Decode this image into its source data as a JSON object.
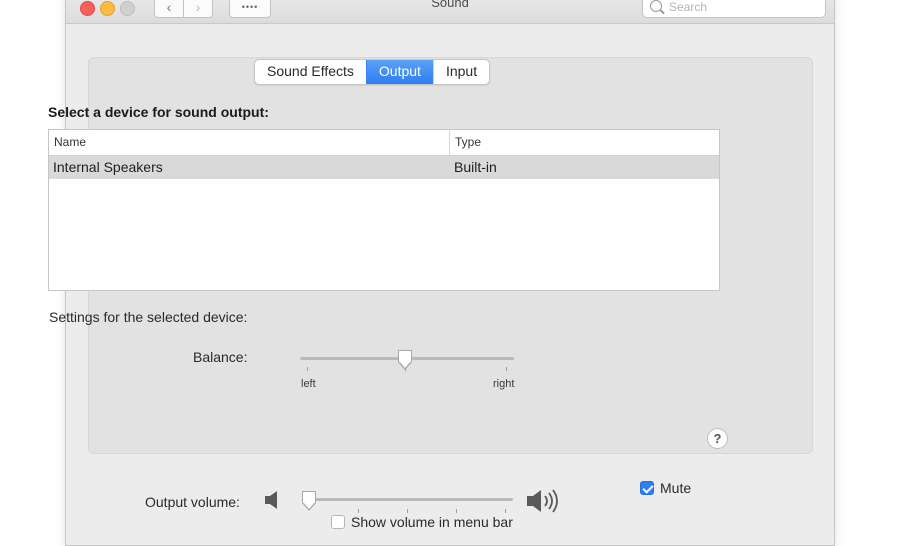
{
  "window": {
    "title": "Sound"
  },
  "toolbar": {
    "search_placeholder": "Search"
  },
  "tabs": [
    {
      "label": "Sound Effects",
      "active": false
    },
    {
      "label": "Output",
      "active": true
    },
    {
      "label": "Input",
      "active": false
    }
  ],
  "output": {
    "heading": "Select a device for sound output:",
    "table": {
      "columns": [
        "Name",
        "Type"
      ],
      "rows": [
        {
          "name": "Internal Speakers",
          "type": "Built-in",
          "selected": true
        }
      ]
    },
    "settings_label": "Settings for the selected device:",
    "balance": {
      "label": "Balance:",
      "left_label": "left",
      "right_label": "right",
      "value": 0.5
    }
  },
  "volume": {
    "label": "Output volume:",
    "level": 0.0,
    "mute_label": "Mute",
    "mute_checked": true,
    "menu_bar_label": "Show volume in menu bar",
    "menu_bar_checked": false
  },
  "colors": {
    "accent": "#2f7ef2",
    "selected_row": "#d9d9d9",
    "panel": "#e2e2e2"
  }
}
